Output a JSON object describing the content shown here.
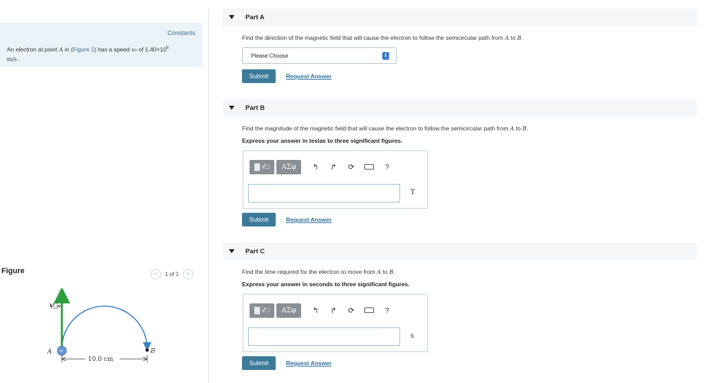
{
  "problem": {
    "constants_link": "Constants",
    "text_prefix": "An electron at point ",
    "point_a": "A",
    "text_in": " in (",
    "figure_link": "Figure 1",
    "text_speed": ") has a speed ",
    "speed_symbol": "v₀",
    "text_of": " of 1.40×10",
    "exponent": "6",
    "unit": "m/s",
    "unit_suffix": " ."
  },
  "figure": {
    "title": "Figure",
    "pager": "1 of 1",
    "prev_icon": "chevron-left-icon",
    "next_icon": "chevron-right-icon",
    "velocity_label": "v⃗₀",
    "point_a_label": "A",
    "point_b_label": "B",
    "distance_label": "10.0 cm",
    "electron_sign": "−",
    "colors": {
      "arc": "#3b7fc4",
      "velocity": "#2e9e3e",
      "electron": "#6a97d4"
    }
  },
  "parts": {
    "a": {
      "title": "Part A",
      "question_prefix": "Find the direction of the magnetic field that will cause the electron to follow the semicircular path from ",
      "point_a": "A",
      "question_mid": " to ",
      "point_b": "B",
      "question_end": ".",
      "select_value": "Please Choose",
      "submit_label": "Submit",
      "request_label": "Request Answer"
    },
    "b": {
      "title": "Part B",
      "question_prefix": "Find the magnitude of the magnetic field that will cause the electron to follow the semicircular path from ",
      "point_a": "A",
      "question_mid": " to ",
      "point_b": "B",
      "question_end": ".",
      "instruction": "Express your answer in teslas to three significant figures.",
      "unit": "T",
      "submit_label": "Submit",
      "request_label": "Request Answer"
    },
    "c": {
      "title": "Part C",
      "question_prefix": "Find the time required for the electron to move from ",
      "point_a": "A",
      "question_mid": " to ",
      "point_b": "B",
      "question_end": ".",
      "instruction": "Express your answer in seconds to three significant figures.",
      "unit": "s",
      "submit_label": "Submit",
      "request_label": "Request Answer"
    }
  },
  "toolbar": {
    "greek_label": "ΑΣφ",
    "radical_label": "√□",
    "undo_icon": "↰",
    "redo_icon": "↱",
    "reset_icon": "⟳",
    "help_label": "?",
    "colors": {
      "button_bg": "#8a8f94",
      "submit_bg": "#3d7a9a",
      "link": "#2e6f9b"
    }
  }
}
